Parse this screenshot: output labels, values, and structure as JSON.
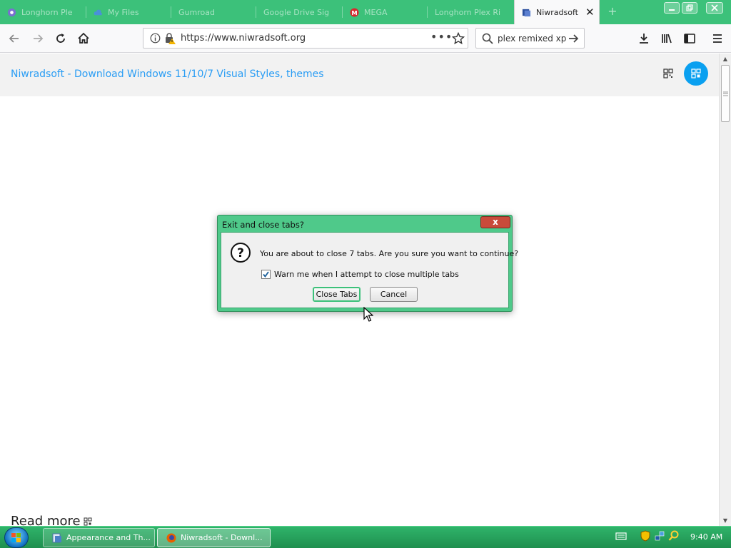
{
  "tabs": [
    {
      "label": "Longhorn Ple",
      "icon": "longhorn-favicon",
      "active": false
    },
    {
      "label": "My Files",
      "icon": "cloud-favicon",
      "active": false
    },
    {
      "label": "Gumroad",
      "icon": "",
      "active": false
    },
    {
      "label": "Google Drive Sig",
      "icon": "",
      "active": false
    },
    {
      "label": "MEGA",
      "icon": "mega-favicon",
      "active": false
    },
    {
      "label": "Longhorn Plex Ri",
      "icon": "",
      "active": false
    },
    {
      "label": "Niwradsoft",
      "icon": "niwradsoft-favicon",
      "active": true
    }
  ],
  "newtab_label": "+",
  "navbar": {
    "url": "https://www.niwradsoft.org",
    "search_text": "plex remixed xp"
  },
  "page": {
    "site_title": "Niwradsoft - Download Windows 11/10/7 Visual Styles, themes",
    "read_more": "Read more"
  },
  "dialog": {
    "title": "Exit and close tabs?",
    "close_label": "x",
    "message": "You are about to close 7 tabs. Are you sure you want to continue?",
    "checkbox_label": "Warn me when I attempt to close multiple tabs",
    "checkbox_checked": true,
    "confirm_label": "Close Tabs",
    "cancel_label": "Cancel"
  },
  "taskbar": {
    "buttons": [
      {
        "label": "Appearance and Th...",
        "icon": "control-panel-icon",
        "active": false
      },
      {
        "label": "Niwradsoft - Downl...",
        "icon": "firefox-icon",
        "active": true
      }
    ],
    "clock": "9:40 AM"
  },
  "colors": {
    "accent": "#3cc17a",
    "link": "#2a9df4",
    "fab": "#0aa0f0",
    "close_red": "#c94a3a"
  }
}
